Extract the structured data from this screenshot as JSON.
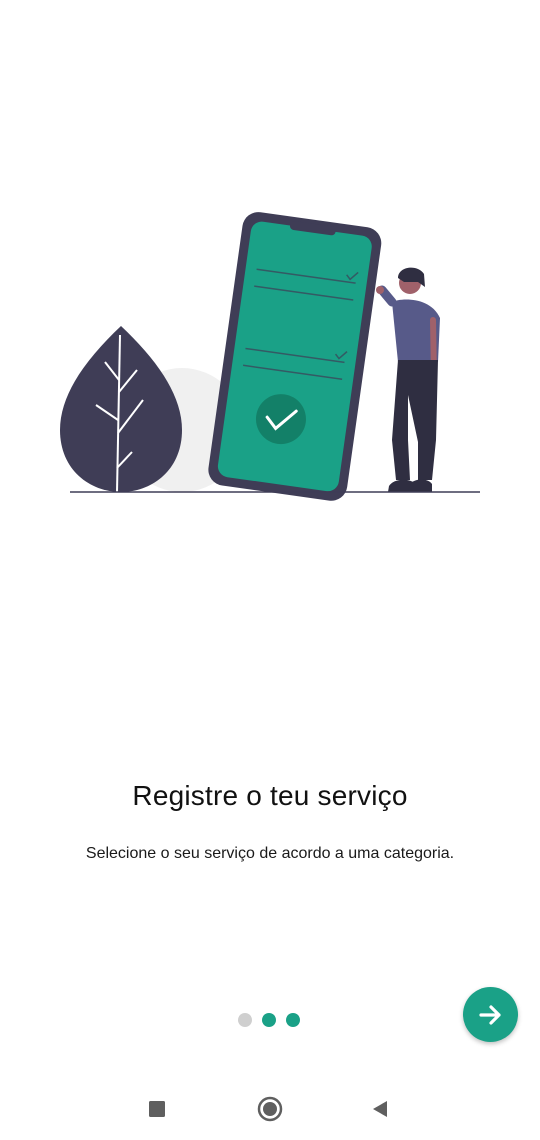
{
  "onboarding": {
    "title": "Registre o teu serviço",
    "subtitle": "Selecione o seu serviço de acordo a uma categoria.",
    "pagination": {
      "total": 3,
      "current": 2
    }
  },
  "colors": {
    "accent": "#1aa187",
    "dot_inactive": "#cfcfcf",
    "leaf": "#3f3d56",
    "phone_screen": "#1aa187",
    "phone_frame": "#3f3d56"
  },
  "icons": {
    "next": "arrow-right-icon",
    "nav_recents": "square-icon",
    "nav_home": "circle-icon",
    "nav_back": "triangle-back-icon"
  }
}
